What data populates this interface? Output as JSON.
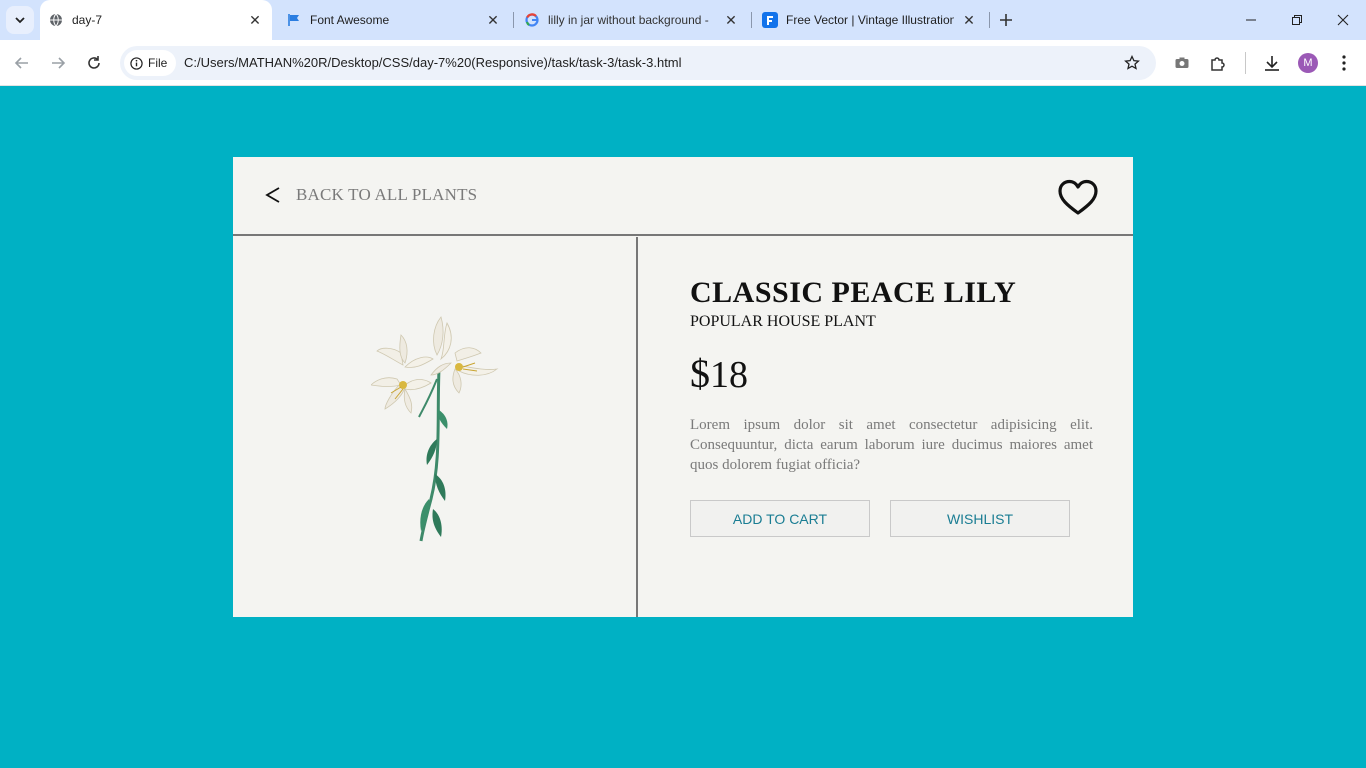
{
  "browser": {
    "tabs": [
      {
        "title": "day-7",
        "icon": "globe-icon",
        "active": true
      },
      {
        "title": "Font Awesome",
        "icon": "flag-icon",
        "active": false
      },
      {
        "title": "lilly in jar without background -",
        "icon": "google-icon",
        "active": false
      },
      {
        "title": "Free Vector | Vintage Illustration",
        "icon": "freepik-icon",
        "active": false
      }
    ],
    "chip_label": "File",
    "url": "C:/Users/MATHAN%20R/Desktop/CSS/day-7%20(Responsive)/task/task-3/task-3.html",
    "avatar_letter": "M"
  },
  "page": {
    "background_color": "#00b1c4",
    "card_color": "#f4f4f1",
    "back_label": "BACK TO ALL PLANTS",
    "product": {
      "title": "CLASSIC PEACE LILY",
      "subtitle": "POPULAR HOUSE PLANT",
      "currency": "$",
      "price": "18",
      "description": "Lorem ipsum dolor sit amet consectetur adipisicing elit. Consequuntur, dicta earum laborum iure ducimus maiores amet quos dolorem fugiat officia?"
    },
    "buttons": {
      "add_to_cart": "ADD TO CART",
      "wishlist": "WISHLIST"
    },
    "accent_color": "#1a7d93"
  }
}
